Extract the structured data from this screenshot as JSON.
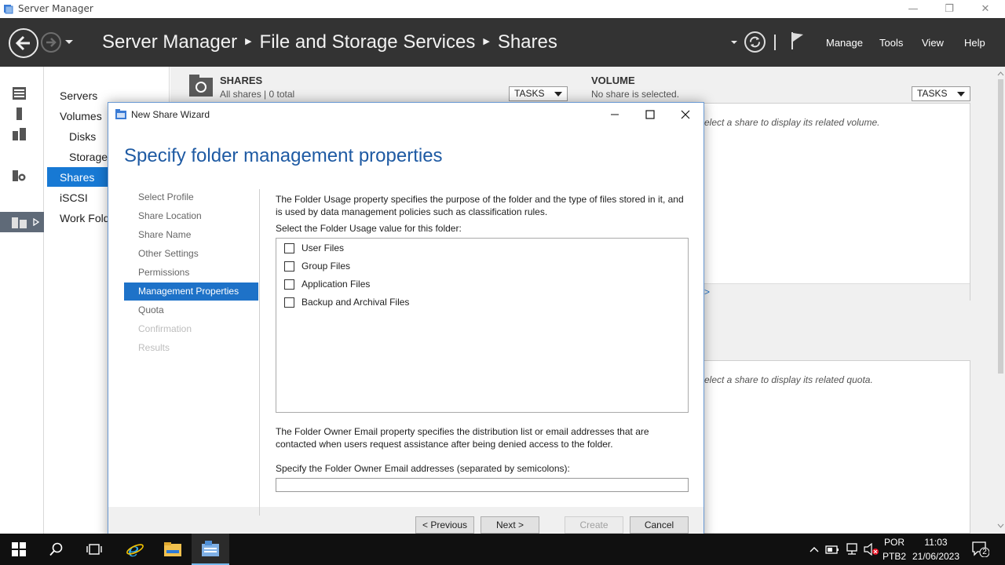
{
  "server_manager": {
    "window_title": "Server Manager",
    "breadcrumb": [
      "Server Manager",
      "File and Storage Services",
      "Shares"
    ],
    "menu": [
      "Manage",
      "Tools",
      "View",
      "Help"
    ],
    "nav_items": [
      "Servers",
      "Volumes",
      "Disks",
      "Storage",
      "Shares",
      "iSCSI",
      "Work Fold"
    ],
    "selected_nav": "Shares"
  },
  "shares_tile": {
    "title": "SHARES",
    "subtitle": "All shares | 0 total",
    "tasks_label": "TASKS"
  },
  "volume_tile": {
    "title": "VOLUME",
    "subtitle": "No share is selected.",
    "tasks_label": "TASKS",
    "hint": "elect a share to display its related volume.",
    "link": ">"
  },
  "quota_tile": {
    "hint": "elect a share to display its related quota."
  },
  "wizard": {
    "title": "New Share Wizard",
    "heading": "Specify folder management properties",
    "steps": [
      {
        "label": "Select Profile",
        "state": "done"
      },
      {
        "label": "Share Location",
        "state": "done"
      },
      {
        "label": "Share Name",
        "state": "done"
      },
      {
        "label": "Other Settings",
        "state": "done"
      },
      {
        "label": "Permissions",
        "state": "done"
      },
      {
        "label": "Management Properties",
        "state": "active"
      },
      {
        "label": "Quota",
        "state": "pending"
      },
      {
        "label": "Confirmation",
        "state": "disabled"
      },
      {
        "label": "Results",
        "state": "disabled"
      }
    ],
    "usage_description": "The Folder Usage property specifies the purpose of the folder and the type of files stored in it, and is used by data management policies such as classification rules.",
    "usage_prompt": "Select the Folder Usage value for this folder:",
    "usage_options": [
      {
        "label": "User Files",
        "checked": false
      },
      {
        "label": "Group Files",
        "checked": false
      },
      {
        "label": "Application Files",
        "checked": false
      },
      {
        "label": "Backup and Archival Files",
        "checked": false
      }
    ],
    "email_description": "The Folder Owner Email property specifies the distribution list or email addresses that are contacted when users request assistance after being denied access to the folder.",
    "email_prompt": "Specify the Folder Owner Email addresses (separated by semicolons):",
    "email_value": "",
    "buttons": {
      "previous": "< Previous",
      "next": "Next >",
      "create": "Create",
      "cancel": "Cancel"
    }
  },
  "taskbar": {
    "language_line1": "POR",
    "language_line2": "PTB2",
    "time": "11:03",
    "date": "21/06/2023",
    "notification_count": "2"
  },
  "colors": {
    "header_bg": "#333333",
    "selection_blue": "#1779d4",
    "wizard_heading": "#1e5aa3",
    "taskbar_bg": "#101010"
  }
}
